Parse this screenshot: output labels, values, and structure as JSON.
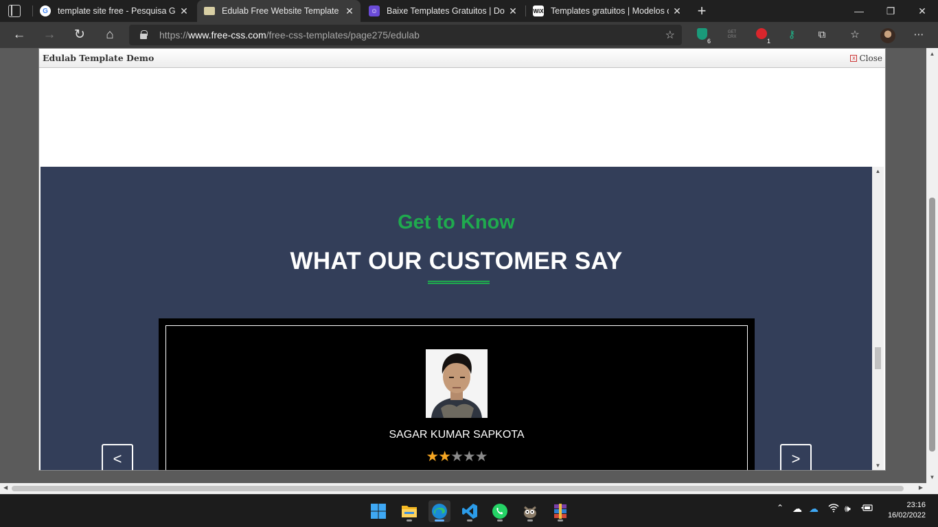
{
  "browser": {
    "tabs": [
      {
        "title": "template site free - Pesquisa Goo",
        "favicon": "google-icon",
        "active": false
      },
      {
        "title": "Edulab Free Website Template | F",
        "favicon": "free-css-icon",
        "active": true
      },
      {
        "title": "Baixe Templates Gratuitos | Dow",
        "favicon": "templates-icon",
        "active": false
      },
      {
        "title": "Templates gratuitos | Modelos d",
        "favicon": "wix-icon",
        "active": false
      }
    ],
    "close_glyph": "✕",
    "favicon_wix_text": "WiX",
    "favicon_google_text": "G",
    "new_tab_glyph": "+",
    "window_controls": {
      "minimize": "—",
      "restore": "❐",
      "close": "✕"
    },
    "address": {
      "prefix": "https://",
      "domain": "www.free-css.com",
      "path": "/free-css-templates/page275/edulab"
    },
    "extensions": {
      "shield_badge": "6",
      "getcrx_label": "GET CRX",
      "addon_badge": "1"
    }
  },
  "demo": {
    "title": "Edulab Template Demo",
    "close_label": "Close",
    "close_box_glyph": "x"
  },
  "testimonial": {
    "kicker": "Get to Know",
    "heading": "WHAT OUR CUSTOMER SAY",
    "prev_label": "<",
    "next_label": ">",
    "customer_name": "SAGAR KUMAR SAPKOTA",
    "rating": 2,
    "max_rating": 5,
    "star_glyph": "★"
  },
  "colors": {
    "accent_green": "#1faa4e",
    "section_bg": "#333e59",
    "star_filled": "#f5a623",
    "star_empty": "#8a8a8a"
  },
  "taskbar": {
    "apps": [
      "windows-start-icon",
      "file-explorer-icon",
      "edge-icon",
      "vscode-icon",
      "whatsapp-icon",
      "gimp-icon",
      "winrar-icon"
    ],
    "time": "23:16",
    "date": "16/02/2022"
  }
}
